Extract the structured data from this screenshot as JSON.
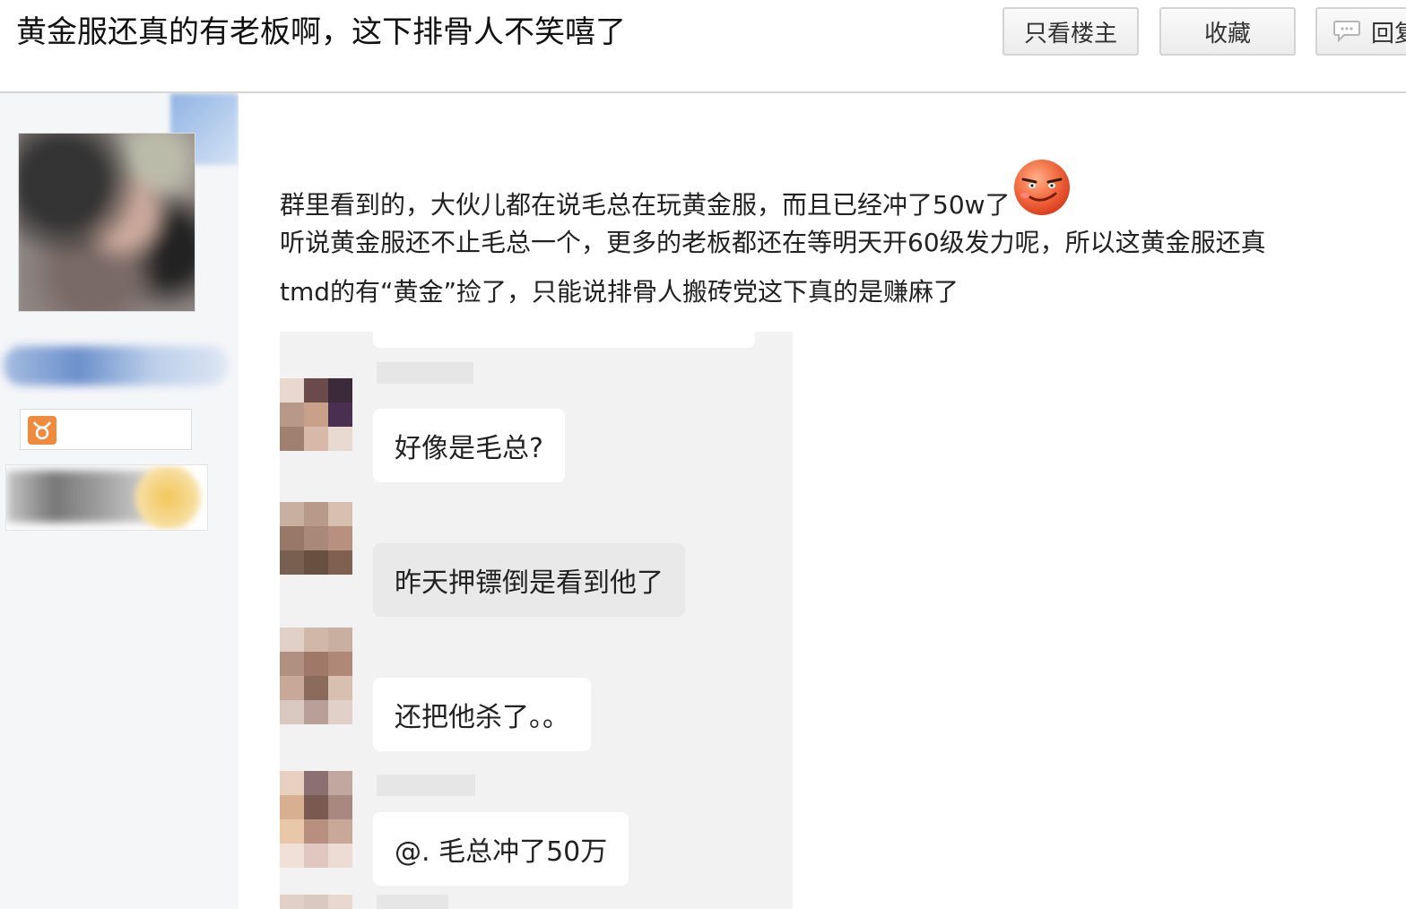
{
  "thread": {
    "title": "黄金服还真的有老板啊，这下排骨人不笑嘻了"
  },
  "toolbar": {
    "only_op_label": "只看楼主",
    "favorite_label": "收藏",
    "reply_label": "回复"
  },
  "post": {
    "lines": [
      "群里看到的，大伙儿都在说毛总在玩黄金服，而且已经冲了50w了",
      "听说黄金服还不止毛总一个，更多的老板都还在等明天开60级发力呢，所以这黄金服还真",
      "tmd的有“黄金”捡了，只能说排骨人搬砖党这下真的是赚麻了"
    ]
  },
  "chat_screenshot": {
    "messages": [
      {
        "text": "好像是毛总?",
        "style": "white"
      },
      {
        "text": "昨天押镖倒是看到他了",
        "style": "gray"
      },
      {
        "text": "还把他杀了。。",
        "style": "white"
      },
      {
        "text": "@. 毛总冲了50万",
        "style": "white"
      }
    ]
  },
  "icons": {
    "reply_icon": "speech-bubble-icon",
    "zodiac_icon": "taurus-icon",
    "emoji": "grinning-face-emoji"
  },
  "colors": {
    "user_column_bg": "#f5f6f8",
    "chat_bg": "#f2f2f2",
    "zodiac_orange": "#f08a3c",
    "emoji_red": "#e8482f"
  }
}
